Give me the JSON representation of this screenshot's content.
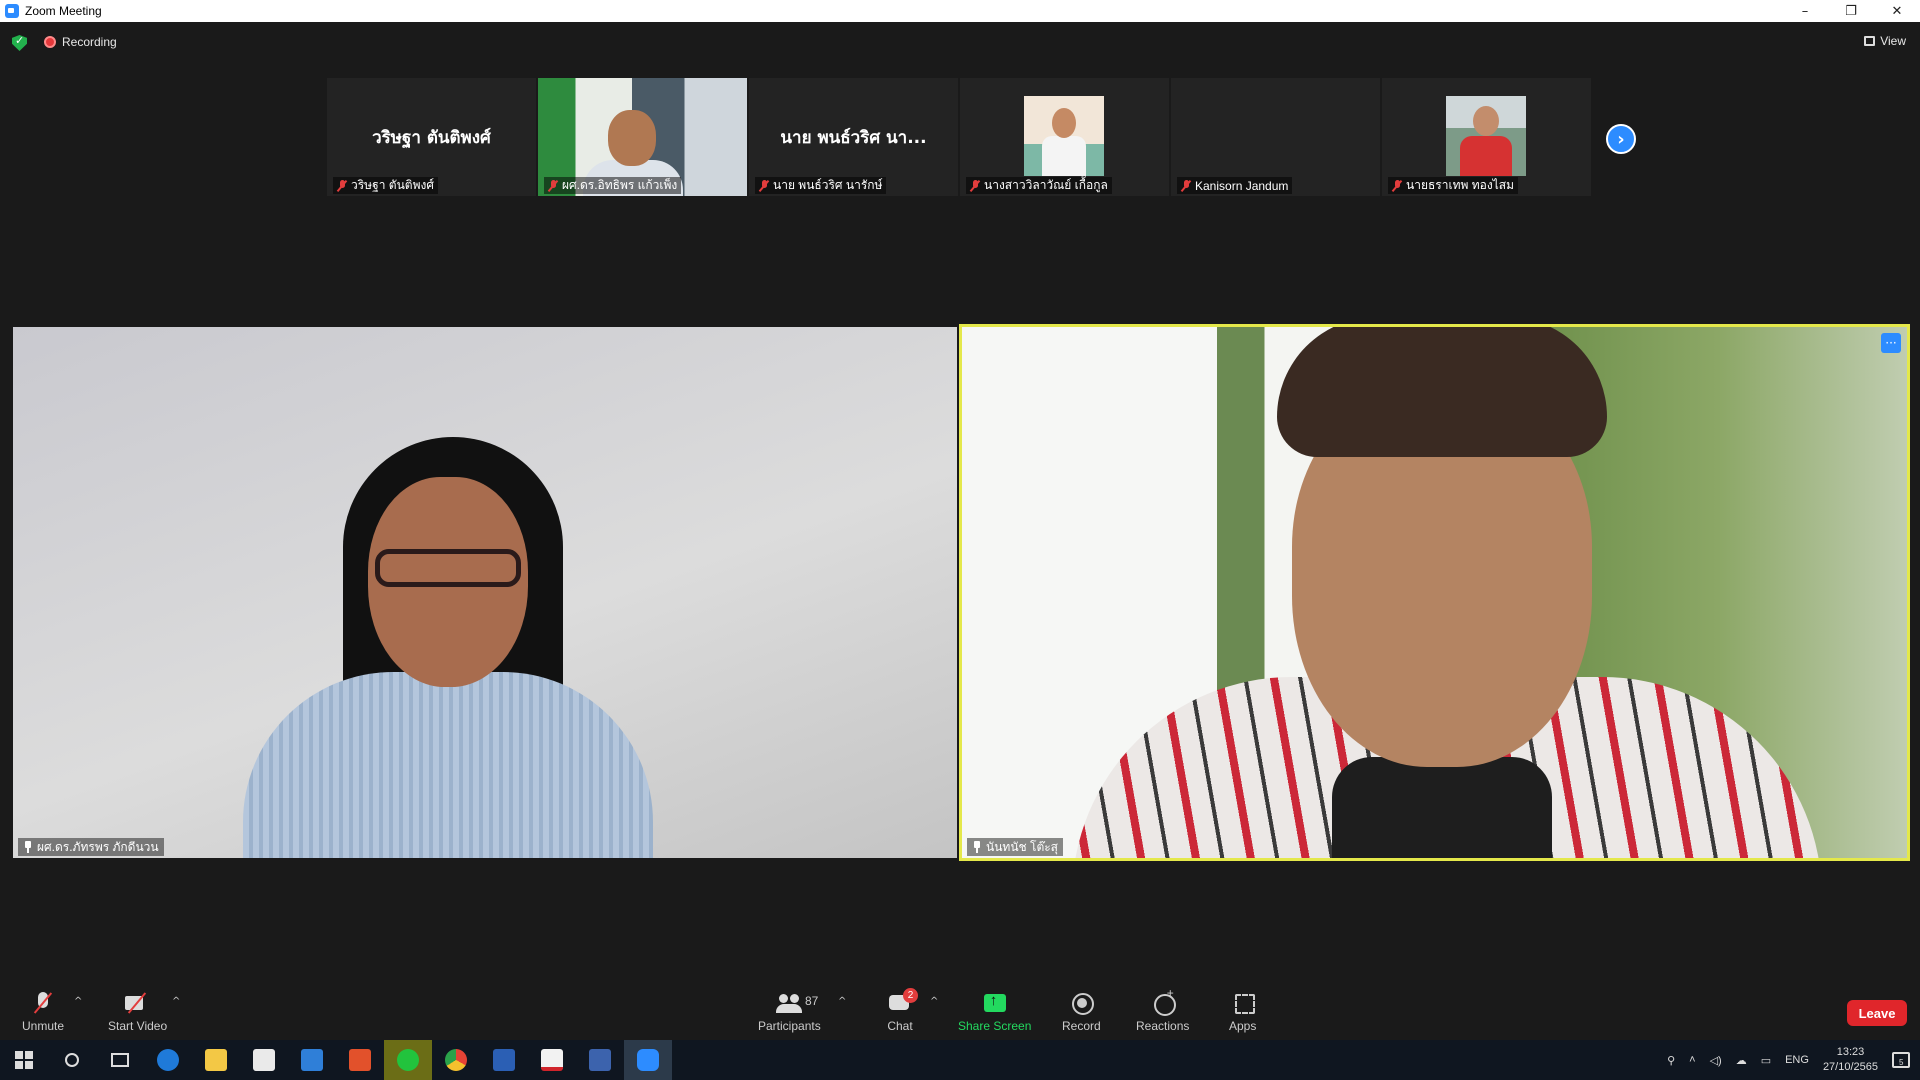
{
  "window": {
    "title": "Zoom Meeting",
    "controls": [
      "–",
      "❐",
      "✕"
    ]
  },
  "topbar": {
    "recording_label": "Recording",
    "view_label": "View"
  },
  "gallery": [
    {
      "display_name": "วริษฐา ตันติพงศ์",
      "label": "วริษฐา ตันติพงศ์",
      "type": "name",
      "muted": true
    },
    {
      "display_name": "",
      "label": "ผศ.ดร.อิทธิพร แก้วเพ็ง",
      "type": "video",
      "muted": true
    },
    {
      "display_name": "นาย พนธ์วริศ นา...",
      "label": "นาย พนธ์วริศ นารักษ์",
      "type": "name",
      "muted": true
    },
    {
      "display_name": "",
      "label": "นางสาววิลาวัณย์ เกื้อกูล",
      "type": "avatar1",
      "muted": true
    },
    {
      "display_name": "",
      "label": "Kanisorn  Jandum",
      "type": "blank",
      "muted": true
    },
    {
      "display_name": "",
      "label": "นายธราเทพ ทองไสม",
      "type": "avatar2",
      "muted": true
    }
  ],
  "next_page_icon": "chevron-right",
  "main_tiles": {
    "left": {
      "name": "ผศ.ดร.ภัทรพร ภักดีนวน"
    },
    "right": {
      "name": "นันทนัช โต๊ะสุ",
      "more": "···"
    }
  },
  "toolbar": {
    "unmute": "Unmute",
    "start_video": "Start Video",
    "participants": "Participants",
    "participants_count": "87",
    "chat": "Chat",
    "chat_badge": "2",
    "share_screen": "Share Screen",
    "record": "Record",
    "reactions": "Reactions",
    "apps": "Apps",
    "leave": "Leave",
    "caret": "^"
  },
  "taskbar": {
    "language": "ENG",
    "time": "13:23",
    "date": "27/10/2565",
    "notification_count": "5"
  },
  "colors": {
    "accent": "#2d8cff",
    "leave": "#e0262b",
    "active_speaker": "#e4e84a",
    "share": "#23d95f"
  }
}
